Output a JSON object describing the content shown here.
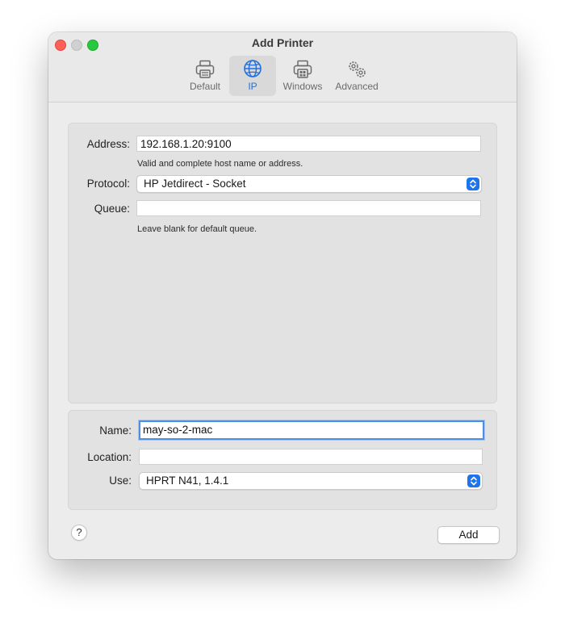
{
  "window": {
    "title": "Add Printer"
  },
  "toolbar": {
    "tabs": [
      {
        "label": "Default",
        "icon": "printer-icon",
        "active": false
      },
      {
        "label": "IP",
        "icon": "globe-icon",
        "active": true
      },
      {
        "label": "Windows",
        "icon": "windows-printer-icon",
        "active": false
      },
      {
        "label": "Advanced",
        "icon": "gears-icon",
        "active": false
      }
    ]
  },
  "ip_panel": {
    "address_label": "Address:",
    "address_value": "192.168.1.20:9100",
    "address_hint": "Valid and complete host name or address.",
    "protocol_label": "Protocol:",
    "protocol_value": "HP Jetdirect - Socket",
    "queue_label": "Queue:",
    "queue_value": "",
    "queue_hint": "Leave blank for default queue."
  },
  "printer_panel": {
    "name_label": "Name:",
    "name_value": "may-so-2-mac",
    "location_label": "Location:",
    "location_value": "",
    "use_label": "Use:",
    "use_value": "HPRT N41, 1.4.1"
  },
  "footer": {
    "help_label": "?",
    "add_label": "Add"
  },
  "colors": {
    "accent": "#1e74ea",
    "focus_ring": "#4a90e8",
    "close": "#fe5f57",
    "maximize": "#28c840"
  }
}
